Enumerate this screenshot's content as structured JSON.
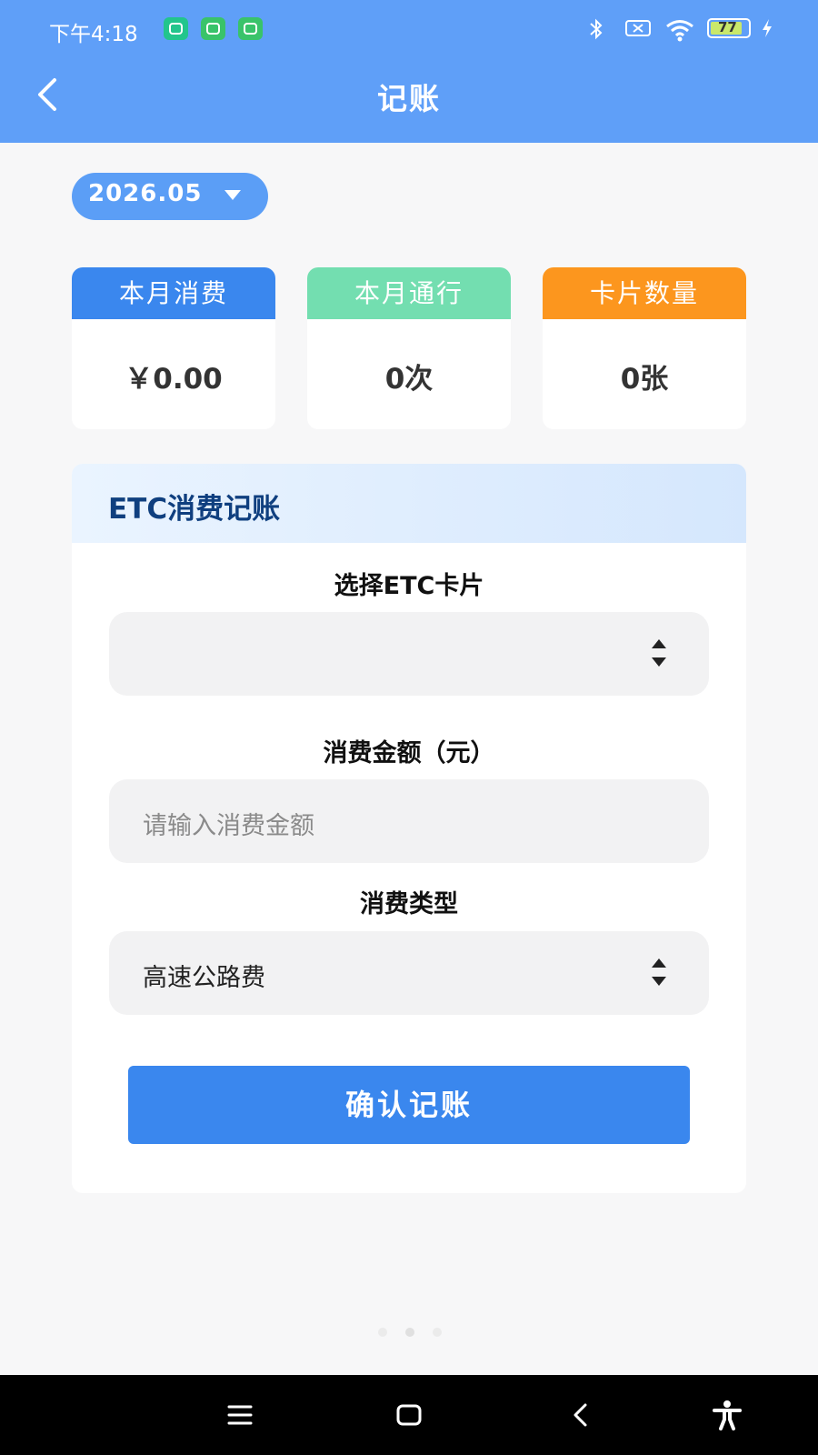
{
  "status_bar": {
    "time": "下午4:18",
    "battery": "77",
    "icons": [
      "app-icon",
      "app-icon",
      "app-icon",
      "bluetooth-icon",
      "notification-icon",
      "wifi-icon",
      "battery-icon",
      "charging-icon"
    ]
  },
  "nav": {
    "title": "记账",
    "back_icon": "chevron-left-icon"
  },
  "month_selector": {
    "value": "2026.05",
    "icon": "caret-down-icon"
  },
  "stats": [
    {
      "label": "本月消费",
      "value": "￥0.00",
      "color": "#3a87ee"
    },
    {
      "label": "本月通行",
      "value": "0次",
      "color": "#73deb0"
    },
    {
      "label": "卡片数量",
      "value": "0张",
      "color": "#fc961e"
    }
  ],
  "form": {
    "title": "ETC消费记账",
    "card_label": "选择ETC卡片",
    "card_value": "",
    "amount_label": "消费金额（元）",
    "amount_placeholder": "请输入消费金额",
    "type_label": "消费类型",
    "type_value": "高速公路费",
    "submit_label": "确认记账"
  },
  "system_nav": {
    "icons": [
      "menu-icon",
      "home-icon",
      "back-icon",
      "accessibility-icon"
    ]
  },
  "colors": {
    "header": "#5f9ff8",
    "primary": "#3a87ee",
    "background": "#f7f7f8"
  }
}
